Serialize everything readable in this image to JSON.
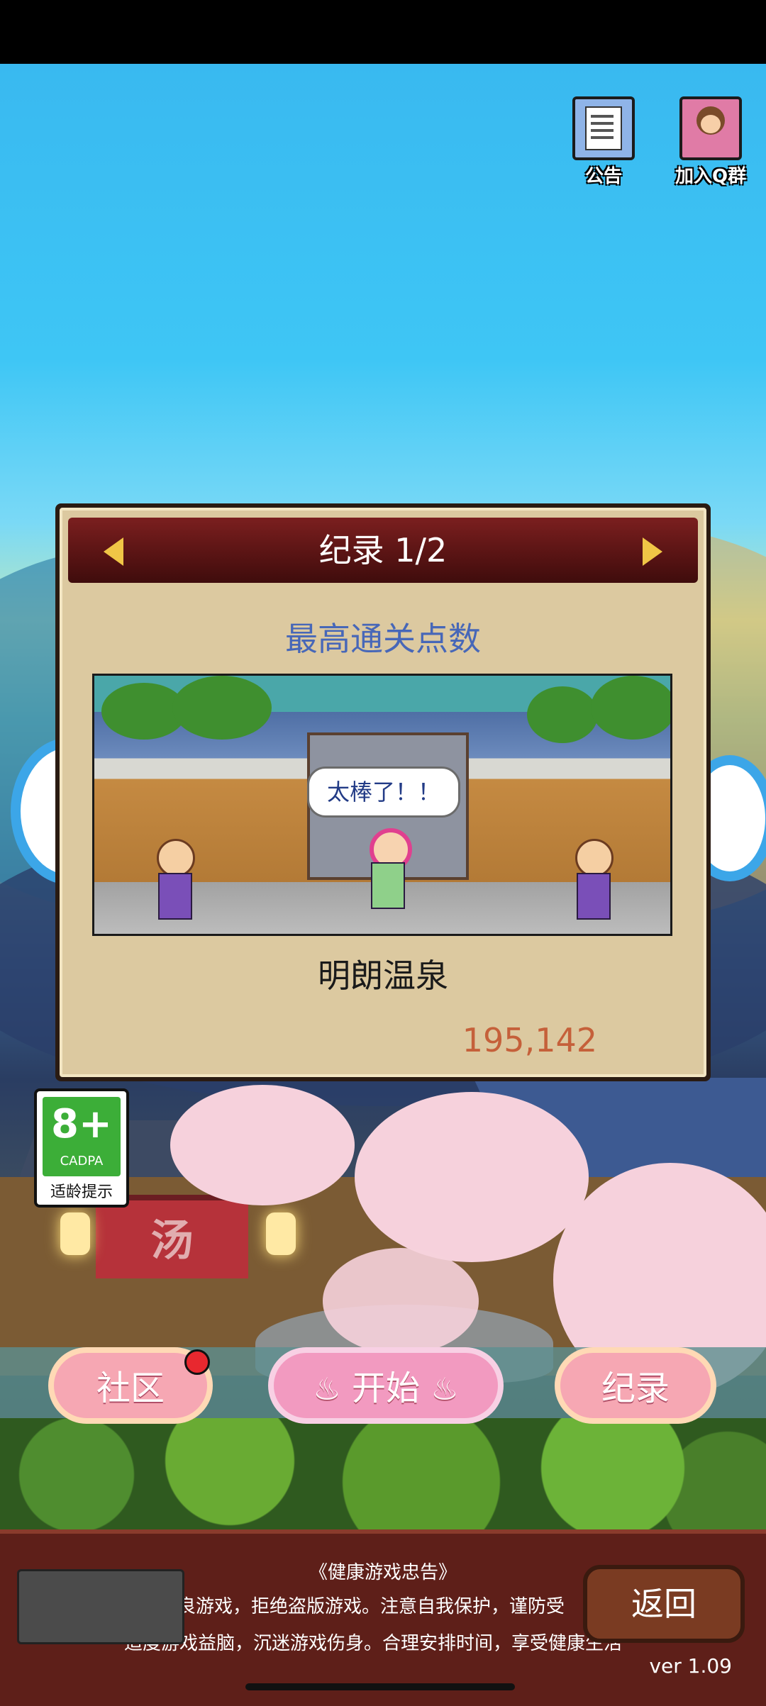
{
  "top_icons": {
    "notice_label": "公告",
    "qq_group_label": "加入Q群"
  },
  "record_dialog": {
    "title": "纪录 1/2",
    "section_label": "最高通关点数",
    "speech_bubble": "太棒了！！",
    "area_name": "明朗温泉",
    "score": "195,142"
  },
  "scene": {
    "noren_char": "汤"
  },
  "age_rating": {
    "age": "8+",
    "org": "CADPA",
    "tip": "适龄提示"
  },
  "buttons": {
    "community": "社区",
    "start": "开始",
    "record": "纪录"
  },
  "health_notice": {
    "title": "《健康游戏忠告》",
    "line1": "良游戏，拒绝盗版游戏。注意自我保护，谨防受",
    "line2": "适度游戏益脑，沉迷游戏伤身。合理安排时间，享受健康生活"
  },
  "back_button": "返回",
  "version": "ver 1.09",
  "colors": {
    "dialog_header": "#5a1414",
    "dialog_body": "#dcc9a0",
    "section_label": "#4767b8",
    "score": "#c5603a",
    "button_pink": "#f6a7b3",
    "panel_brown": "#5e1f19"
  },
  "icons": [
    "notice-icon",
    "qq-group-icon",
    "arrow-left-icon",
    "arrow-right-icon",
    "steam-icon",
    "notification-dot"
  ]
}
